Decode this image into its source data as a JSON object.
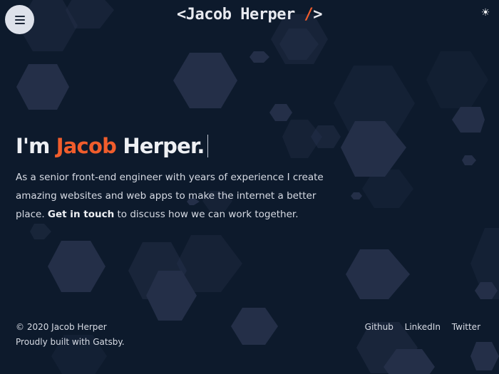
{
  "header": {
    "menu_icon": "hamburger-icon",
    "logo_prefix": "<",
    "logo_text": "Jacob Herper",
    "logo_slash": "/",
    "logo_suffix": ">",
    "theme_icon": "sun-icon",
    "theme_glyph": "☀"
  },
  "hero": {
    "greeting": "I'm",
    "first_name": "Jacob",
    "last_name": "Herper.",
    "intro": "As a senior front-end engineer with years of experience I create amazing websites and web apps to make the internet a better place.",
    "cta_link": "Get in touch",
    "cta_tail": "to discuss how we can work together."
  },
  "footer": {
    "copyright": "© 2020 Jacob Herper",
    "built_with": "Proudly built with Gatsby.",
    "links": [
      "Github",
      "LinkedIn",
      "Twitter"
    ]
  },
  "colors": {
    "background": "#0d1a2c",
    "accent": "#f05d2c",
    "hexagon": "#2a3550"
  }
}
